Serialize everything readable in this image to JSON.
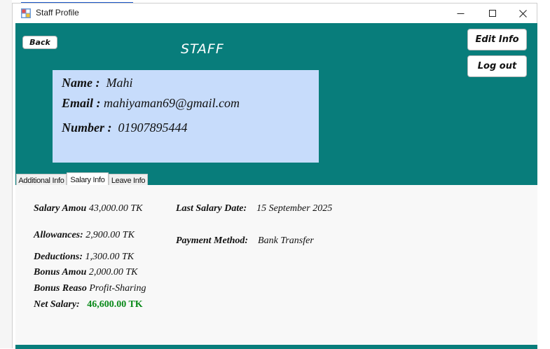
{
  "window": {
    "title": "Staff Profile",
    "controls": {
      "minimize": "—",
      "maximize": "☐",
      "close": "✕"
    }
  },
  "header": {
    "back_label": "Back",
    "title": "STAFF",
    "edit_label": "Edit Info",
    "logout_label": "Log out",
    "accent_color": "#087d7b"
  },
  "profile": {
    "name_label": "Name :",
    "name": "Mahi",
    "email_label": "Email :",
    "email": "mahiyaman69@gmail.com",
    "number_label": "Number :",
    "number": "01907895444"
  },
  "tabs": [
    {
      "label": "Additional Info",
      "selected": false
    },
    {
      "label": "Salary Info",
      "selected": true
    },
    {
      "label": "Leave Info",
      "selected": false
    }
  ],
  "salary": {
    "salary_label": "Salary Amou",
    "salary_value": "43,000.00 TK",
    "allowances_label": "Allowances:",
    "allowances_value": "2,900.00 TK",
    "deductions_label": "Deductions:",
    "deductions_value": "1,300.00 TK",
    "bonus_label": "Bonus Amou",
    "bonus_value": "2,000.00 TK",
    "bonus_reason_label": "Bonus Reaso",
    "bonus_reason_value": "Profit-Sharing",
    "net_label": "Net Salary:",
    "net_value": "46,600.00 TK",
    "last_date_label": "Last Salary Date:",
    "last_date_value": "15 September 2025",
    "payment_label": "Payment Method:",
    "payment_value": "Bank Transfer"
  }
}
